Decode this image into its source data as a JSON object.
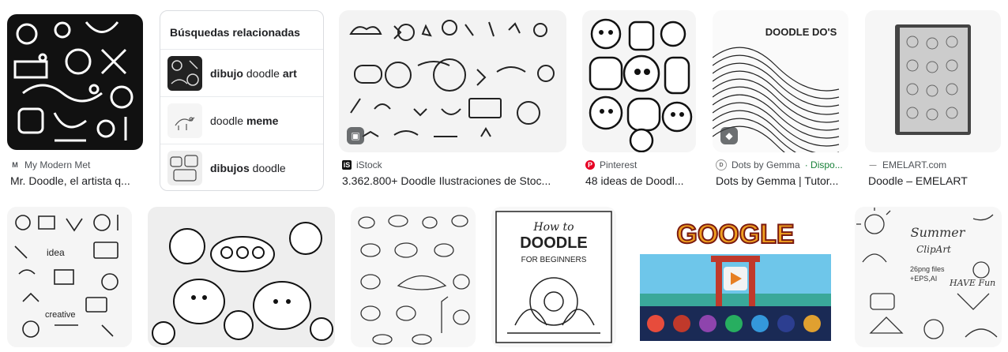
{
  "top_row": [
    {
      "source": "My Modern Met",
      "favicon": "M",
      "title": "Mr. Doodle, el artista q..."
    },
    {
      "source": "iStock",
      "favicon": "iS",
      "title": "3.362.800+ Doodle Ilustraciones de Stoc..."
    },
    {
      "source": "Pinterest",
      "favicon": "P",
      "title": "48 ideas de Doodl..."
    },
    {
      "source": "Dots by Gemma",
      "availability": "· Dispo...",
      "favicon": "D",
      "title": "Dots by Gemma | Tutor...",
      "image_text": "DOODLE DO'S"
    },
    {
      "source": "EMELART.com",
      "favicon": "—",
      "title": "Doodle – EMELART"
    }
  ],
  "related": {
    "heading": "Búsquedas relacionadas",
    "items": [
      {
        "bold1": "dibujo",
        "plain": " doodle ",
        "bold2": "art"
      },
      {
        "bold1": "",
        "plain": "doodle ",
        "bold2": "meme"
      },
      {
        "bold1": "dibujos",
        "plain": " doodle",
        "bold2": ""
      }
    ]
  },
  "bottom_row": [
    {
      "image_text_1": "idea",
      "image_text_2": "creative"
    },
    {},
    {},
    {
      "image_text_1": "How to",
      "image_text_2": "DOODLE",
      "image_text_3": "FOR BEGINNERS"
    },
    {
      "image_text_1": "GOOGLE"
    },
    {
      "image_text_1": "Summer",
      "image_text_2": "ClipArt",
      "image_text_3": "26png files",
      "image_text_4": "+EPS,AI",
      "image_text_5": "HAVE Fun"
    }
  ],
  "colors": {
    "pinterest": "#e60023",
    "availability": "#188038"
  }
}
